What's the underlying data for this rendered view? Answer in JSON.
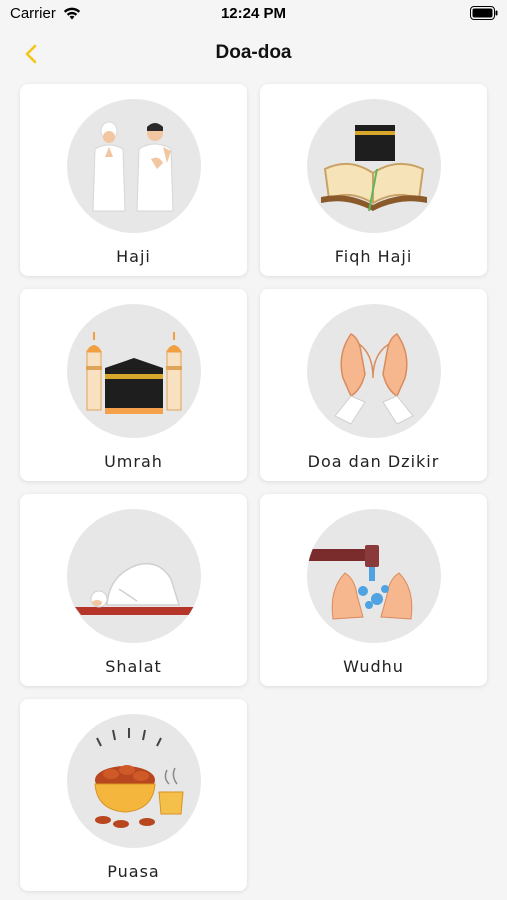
{
  "status_bar": {
    "carrier": "Carrier",
    "time": "12:24 PM",
    "icons": [
      "wifi-icon",
      "battery-icon"
    ]
  },
  "nav": {
    "title": "Doa-doa",
    "back_icon": "chevron-left-icon",
    "accent_color": "#f5c518"
  },
  "categories": [
    {
      "label": "Haji",
      "icon": "pilgrims-illustration"
    },
    {
      "label": "Fiqh Haji",
      "icon": "kaaba-quran-illustration"
    },
    {
      "label": "Umrah",
      "icon": "kaaba-minarets-illustration"
    },
    {
      "label": "Doa dan Dzikir",
      "icon": "praying-hands-illustration"
    },
    {
      "label": "Shalat",
      "icon": "prostration-illustration"
    },
    {
      "label": "Wudhu",
      "icon": "ablution-hands-illustration"
    },
    {
      "label": "Puasa",
      "icon": "dates-bowl-illustration"
    }
  ]
}
